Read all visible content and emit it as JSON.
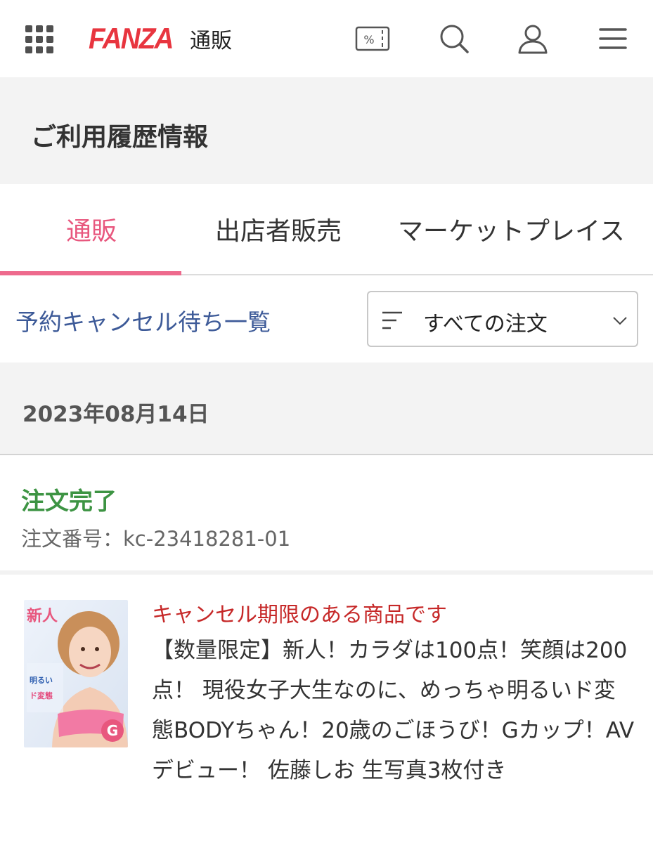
{
  "header": {
    "brand": "FANZA",
    "brand_sub": "通販",
    "coupon_icon_text": "%",
    "icons": [
      "grid-menu-icon",
      "coupon-icon",
      "search-icon",
      "user-icon",
      "hamburger-menu-icon"
    ],
    "brand_color": "#e8353f"
  },
  "page": {
    "title": "ご利用履歴情報"
  },
  "tabs": [
    {
      "label": "通販",
      "active": true
    },
    {
      "label": "出店者販売",
      "active": false
    },
    {
      "label": "マーケットプレイス",
      "active": false
    }
  ],
  "filter": {
    "cancel_link": "予約キャンセル待ち一覧",
    "select_value": "すべての注文"
  },
  "order": {
    "date": "2023年08月14日",
    "status": "注文完了",
    "number_label": "注文番号：kc-23418281-01"
  },
  "product": {
    "cancel_note": "キャンセル期限のある商品です",
    "title": "【数量限定】新人！カラダは100点！笑顔は200点！ 現役女子大生なのに、めっちゃ明るいド変態BODYちゃん！20歳のごほうび！Gカップ！AVデビュー！ 佐藤しお 生写真3枚付き",
    "thumb_text": "新人"
  },
  "colors": {
    "accent_pink": "#ee6a8d",
    "status_green": "#3d9443",
    "link_blue": "#3d5a98",
    "warning_red": "#c62828"
  }
}
